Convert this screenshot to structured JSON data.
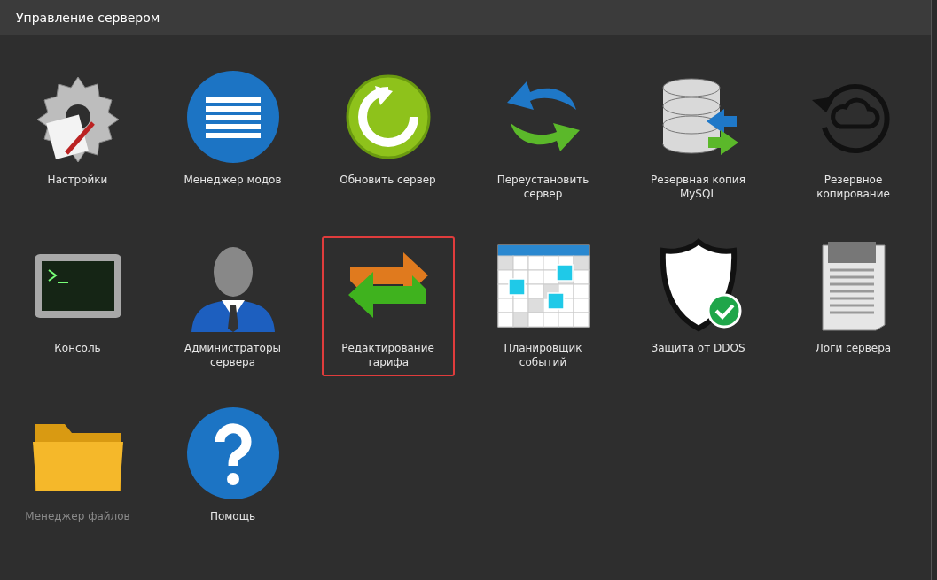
{
  "panel": {
    "title": "Управление сервером"
  },
  "tiles": [
    {
      "kind": "settings",
      "label": "Настройки",
      "selected": false,
      "disabled": false
    },
    {
      "kind": "mods",
      "label": "Менеджер модов",
      "selected": false,
      "disabled": false
    },
    {
      "kind": "update",
      "label": "Обновить сервер",
      "selected": false,
      "disabled": false
    },
    {
      "kind": "reinstall",
      "label": "Переустановить сервер",
      "selected": false,
      "disabled": false
    },
    {
      "kind": "mysql",
      "label": "Резервная копия MySQL",
      "selected": false,
      "disabled": false
    },
    {
      "kind": "backup",
      "label": "Резервное копирование",
      "selected": false,
      "disabled": false
    },
    {
      "kind": "console",
      "label": "Консоль",
      "selected": false,
      "disabled": false
    },
    {
      "kind": "admins",
      "label": "Администраторы сервера",
      "selected": false,
      "disabled": false
    },
    {
      "kind": "tariff",
      "label": "Редактирование тарифа",
      "selected": true,
      "disabled": false
    },
    {
      "kind": "scheduler",
      "label": "Планировщик событий",
      "selected": false,
      "disabled": false
    },
    {
      "kind": "ddos",
      "label": "Защита от DDOS",
      "selected": false,
      "disabled": false
    },
    {
      "kind": "logs",
      "label": "Логи сервера",
      "selected": false,
      "disabled": false
    },
    {
      "kind": "files",
      "label": "Менеджер файлов",
      "selected": false,
      "disabled": true
    },
    {
      "kind": "help",
      "label": "Помощь",
      "selected": false,
      "disabled": false
    }
  ]
}
